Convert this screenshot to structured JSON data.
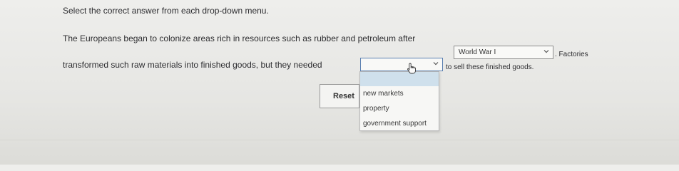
{
  "instruction": "Select the correct answer from each drop-down menu.",
  "sentence": {
    "part1": "The Europeans began to colonize areas rich in resources such as rubber and petroleum after",
    "part2": ". Factories",
    "part3": "transformed such raw materials into finished goods, but they needed",
    "part4": "to sell these finished goods."
  },
  "dropdown1": {
    "selected": "World War I",
    "icon": "chevron-down-icon"
  },
  "dropdown2": {
    "selected": "",
    "state": "open",
    "options": [
      "new markets",
      "property",
      "government support"
    ],
    "icon": "chevron-down-icon"
  },
  "reset_label": "Reset",
  "colors": {
    "highlight": "#cfe0ec",
    "focus_border": "#5a7fb0"
  }
}
